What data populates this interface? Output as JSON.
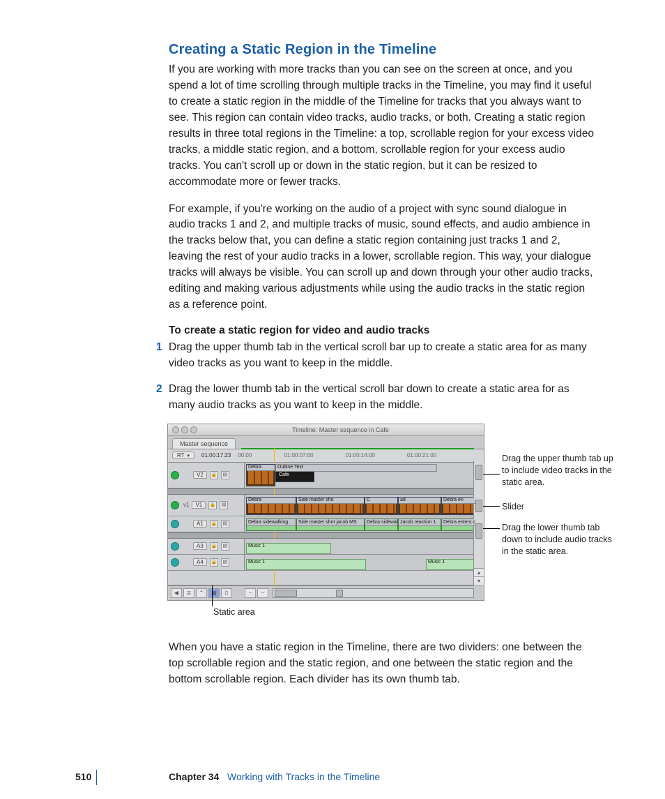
{
  "heading": "Creating a Static Region in the Timeline",
  "para1": "If you are working with more tracks than you can see on the screen at once, and you spend a lot of time scrolling through multiple tracks in the Timeline, you may find it useful to create a static region in the middle of the Timeline for tracks that you always want to see. This region can contain video tracks, audio tracks, or both. Creating a static region results in three total regions in the Timeline: a top, scrollable region for your excess video tracks, a middle static region, and a bottom, scrollable region for your excess audio tracks. You can't scroll up or down in the static region, but it can be resized to accommodate more or fewer tracks.",
  "para2": "For example, if you're working on the audio of a project with sync sound dialogue in audio tracks 1 and 2, and multiple tracks of music, sound effects, and audio ambience in the tracks below that, you can define a static region containing just tracks 1 and 2, leaving the rest of your audio tracks in a lower, scrollable region. This way, your dialogue tracks will always be visible. You can scroll up and down through your other audio tracks, editing and making various adjustments while using the audio tracks in the static region as a reference point.",
  "subhead": "To create a static region for video and audio tracks",
  "steps": [
    "Drag the upper thumb tab in the vertical scroll bar up to create a static area for as many video tracks as you want to keep in the middle.",
    "Drag the lower thumb tab in the vertical scroll bar down to create a static area for as many audio tracks as you want to keep in the middle."
  ],
  "para3": "When you have a static region in the Timeline, there are two dividers: one between the top scrollable region and the static region, and one between the static region and the bottom scrollable region. Each divider has its own thumb tab.",
  "screenshot": {
    "window_title": "Timeline: Master sequence in Cafe",
    "tab": "Master sequence",
    "rt_button": "RT",
    "current_tc": "01:00:17:23",
    "ruler_ticks": [
      "00:00",
      "01:00:07:00",
      "01:00:14:00",
      "01:00:21:00"
    ],
    "tracks": {
      "v2": {
        "label": "V2",
        "clip_outline": "Outline Text",
        "clip_cafe": "Cafe"
      },
      "v1": {
        "src": "v1",
        "label": "V1",
        "clips": [
          "Debra",
          "Side master sho",
          "C",
          "ad",
          "Debra en"
        ]
      },
      "a1": {
        "label": "A1",
        "clips": [
          "Debra sidewalking",
          "Side master shot jacob MS",
          "Debra sidewal",
          "Jacob reaction 1",
          "Debra enters cafe WS"
        ]
      },
      "a3": {
        "label": "A3",
        "clip": "Music 1"
      },
      "a4": {
        "label": "A4",
        "clips": [
          "Music 1",
          "Music 1"
        ]
      }
    }
  },
  "callouts": {
    "upper": "Drag the upper thumb tab up to include video tracks in the static area.",
    "slider": "Slider",
    "lower": "Drag the lower thumb tab down to include audio tracks in the static area.",
    "static": "Static area"
  },
  "footer": {
    "page": "510",
    "chapter_label": "Chapter 34",
    "chapter_title": "Working with Tracks in the Timeline"
  }
}
